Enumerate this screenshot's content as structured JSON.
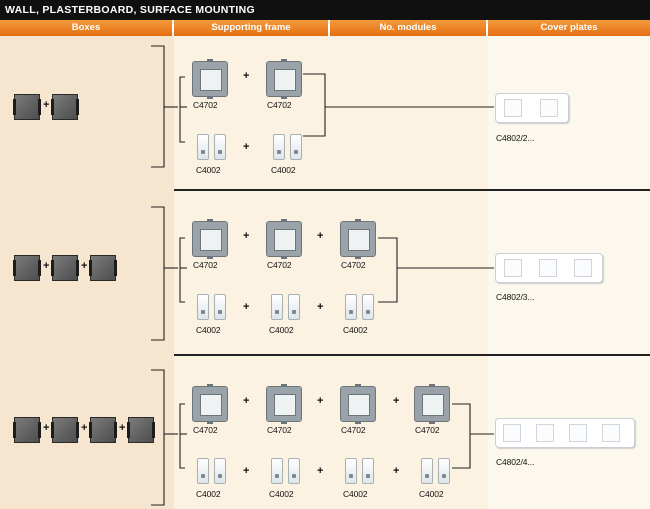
{
  "title": "WALL, PLASTERBOARD, SURFACE MOUNTING",
  "columns": [
    "Boxes",
    "Supporting frame",
    "No. modules",
    "Cover plates"
  ],
  "plus_sign": "+",
  "frame_code": "C4702",
  "module_code": "C4002",
  "rows": [
    {
      "boxes": 2,
      "cover_plate": "C4802/2..."
    },
    {
      "boxes": 3,
      "cover_plate": "C4802/3..."
    },
    {
      "boxes": 4,
      "cover_plate": "C4802/4..."
    }
  ],
  "colors": {
    "header_orange": "#e8761a",
    "title_bar": "#101010",
    "background": "#fbf4e6"
  }
}
